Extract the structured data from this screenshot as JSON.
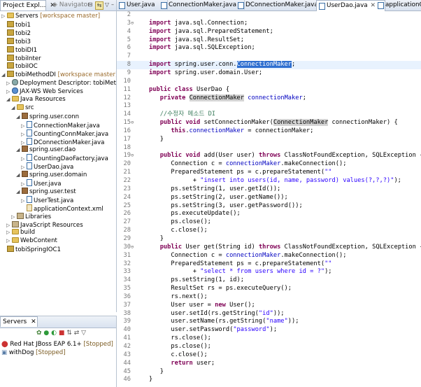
{
  "left_panel": {
    "tabs": [
      {
        "label": "Project Expl...",
        "active": true
      },
      {
        "label": "Navigator",
        "active": false
      }
    ],
    "tree": [
      {
        "label": "Servers",
        "ann": " [workspace master]",
        "indent": 0,
        "twisty": "▷",
        "icon": "folder"
      },
      {
        "label": "tobi1",
        "ann": "",
        "indent": 0,
        "twisty": "",
        "icon": "proj"
      },
      {
        "label": "tobi2",
        "ann": "",
        "indent": 0,
        "twisty": "",
        "icon": "proj"
      },
      {
        "label": "tobi3",
        "ann": "",
        "indent": 0,
        "twisty": "",
        "icon": "proj"
      },
      {
        "label": "tobiDI1",
        "ann": "",
        "indent": 0,
        "twisty": "",
        "icon": "proj"
      },
      {
        "label": "tobiInter",
        "ann": "",
        "indent": 0,
        "twisty": "",
        "icon": "proj"
      },
      {
        "label": "tobiIOC",
        "ann": "",
        "indent": 0,
        "twisty": "",
        "icon": "proj"
      },
      {
        "label": "tobiMethodDI",
        "ann": " [workspace master]",
        "indent": 0,
        "twisty": "◢",
        "icon": "proj"
      },
      {
        "label": "Deployment Descriptor: tobiMethodI",
        "ann": "",
        "indent": 1,
        "twisty": "▷",
        "icon": "gear"
      },
      {
        "label": "JAX-WS Web Services",
        "ann": "",
        "indent": 1,
        "twisty": "▷",
        "icon": "web"
      },
      {
        "label": "Java Resources",
        "ann": "",
        "indent": 1,
        "twisty": "◢",
        "icon": "folder"
      },
      {
        "label": "src",
        "ann": "",
        "indent": 2,
        "twisty": "◢",
        "icon": "folder"
      },
      {
        "label": "spring.user.conn",
        "ann": "",
        "indent": 3,
        "twisty": "◢",
        "icon": "pkg"
      },
      {
        "label": "ConnectionMaker.java",
        "ann": "",
        "indent": 4,
        "twisty": "▷",
        "icon": "java"
      },
      {
        "label": "CountingConnMaker.java",
        "ann": "",
        "indent": 4,
        "twisty": "▷",
        "icon": "java"
      },
      {
        "label": "DConnectionMaker.java",
        "ann": "",
        "indent": 4,
        "twisty": "▷",
        "icon": "java"
      },
      {
        "label": "spring.user.dao",
        "ann": "",
        "indent": 3,
        "twisty": "◢",
        "icon": "pkg"
      },
      {
        "label": "CountingDaoFactory.java",
        "ann": "",
        "indent": 4,
        "twisty": "▷",
        "icon": "java"
      },
      {
        "label": "UserDao.java",
        "ann": "",
        "indent": 4,
        "twisty": "▷",
        "icon": "java"
      },
      {
        "label": "spring.user.domain",
        "ann": "",
        "indent": 3,
        "twisty": "◢",
        "icon": "pkg"
      },
      {
        "label": "User.java",
        "ann": "",
        "indent": 4,
        "twisty": "▷",
        "icon": "java"
      },
      {
        "label": "spring.user.test",
        "ann": "",
        "indent": 3,
        "twisty": "◢",
        "icon": "pkg"
      },
      {
        "label": "UserTest.java",
        "ann": "",
        "indent": 4,
        "twisty": "▷",
        "icon": "java"
      },
      {
        "label": "applicationContext.xml",
        "ann": "",
        "indent": 4,
        "twisty": "",
        "icon": "xml"
      },
      {
        "label": "Libraries",
        "ann": "",
        "indent": 2,
        "twisty": "▷",
        "icon": "lib"
      },
      {
        "label": "JavaScript Resources",
        "ann": "",
        "indent": 1,
        "twisty": "▷",
        "icon": "lib"
      },
      {
        "label": "build",
        "ann": "",
        "indent": 1,
        "twisty": "▷",
        "icon": "folder"
      },
      {
        "label": "WebContent",
        "ann": "",
        "indent": 1,
        "twisty": "▷",
        "icon": "folder"
      },
      {
        "label": "tobiSpringIOC1",
        "ann": "",
        "indent": 0,
        "twisty": "",
        "icon": "proj"
      }
    ]
  },
  "servers_panel": {
    "tab": "Servers",
    "items": [
      {
        "name": "Red Hat JBoss EAP 6.1+",
        "status": " [Stopped]"
      },
      {
        "name": "withDog",
        "status": " [Stopped]"
      }
    ]
  },
  "editor": {
    "tabs": [
      {
        "label": "User.java",
        "active": false
      },
      {
        "label": "ConnectionMaker.java",
        "active": false
      },
      {
        "label": "DConnectionMaker.java",
        "active": false
      },
      {
        "label": "UserDao.java",
        "active": true
      },
      {
        "label": "applicationCor",
        "active": false
      }
    ],
    "current_line": 8,
    "lines": [
      {
        "n": "2",
        "fold": "",
        "html": ""
      },
      {
        "n": "3",
        "fold": "⊖",
        "html": "<span class='k'>import</span> java.sql.Connection;"
      },
      {
        "n": "4",
        "fold": "",
        "html": "<span class='k'>import</span> java.sql.PreparedStatement;"
      },
      {
        "n": "5",
        "fold": "",
        "html": "<span class='k'>import</span> java.sql.ResultSet;"
      },
      {
        "n": "6",
        "fold": "",
        "html": "<span class='k'>import</span> java.sql.SQLException;"
      },
      {
        "n": "7",
        "fold": "",
        "html": ""
      },
      {
        "n": "8",
        "fold": "",
        "html": "<span class='k'>import</span> spring.user.conn.<span class='sel'>ConnectionMaker</span>;"
      },
      {
        "n": "9",
        "fold": "",
        "html": "<span class='k'>import</span> spring.user.domain.User;"
      },
      {
        "n": "10",
        "fold": "",
        "html": ""
      },
      {
        "n": "11",
        "fold": "",
        "html": "<span class='k'>public</span> <span class='k'>class</span> UserDao {"
      },
      {
        "n": "12",
        "fold": "",
        "html": "   <span class='k'>private</span> <span class='sh'>ConnectionMaker</span> <span class='f'>connectionMaker</span>;"
      },
      {
        "n": "13",
        "fold": "",
        "html": ""
      },
      {
        "n": "14",
        "fold": "",
        "html": "   <span class='c'>//수정자 메소드 DI</span>"
      },
      {
        "n": "15",
        "fold": "⊖",
        "html": "   <span class='k'>public</span> <span class='k'>void</span> setConnectionMaker(<span class='sh'>ConnectionMaker</span> connectionMaker) {"
      },
      {
        "n": "16",
        "fold": "",
        "html": "      <span class='k'>this</span>.<span class='f'>connectionMaker</span> = connectionMaker;"
      },
      {
        "n": "17",
        "fold": "",
        "html": "   }"
      },
      {
        "n": "18",
        "fold": "",
        "html": ""
      },
      {
        "n": "19",
        "fold": "⊖",
        "html": "   <span class='k'>public</span> <span class='k'>void</span> add(User user) <span class='k'>throws</span> ClassNotFoundException, SQLException {"
      },
      {
        "n": "20",
        "fold": "",
        "html": "      Connection c = <span class='f'>connectionMaker</span>.makeConnection();"
      },
      {
        "n": "21",
        "fold": "",
        "html": "      PreparedStatement ps = c.prepareStatement(<span class='s'>\"\"</span>"
      },
      {
        "n": "22",
        "fold": "",
        "html": "            + <span class='s'>\"insert into users(id, name, password) values(?,?,?)\"</span>);"
      },
      {
        "n": "23",
        "fold": "",
        "html": "      ps.setString(1, user.getId());"
      },
      {
        "n": "24",
        "fold": "",
        "html": "      ps.setString(2, user.getName());"
      },
      {
        "n": "25",
        "fold": "",
        "html": "      ps.setString(3, user.getPassword());"
      },
      {
        "n": "26",
        "fold": "",
        "html": "      ps.executeUpdate();"
      },
      {
        "n": "27",
        "fold": "",
        "html": "      ps.close();"
      },
      {
        "n": "28",
        "fold": "",
        "html": "      c.close();"
      },
      {
        "n": "29",
        "fold": "",
        "html": "   }"
      },
      {
        "n": "30",
        "fold": "⊖",
        "html": "   <span class='k'>public</span> User get(String id) <span class='k'>throws</span> ClassNotFoundException, SQLException {"
      },
      {
        "n": "31",
        "fold": "",
        "html": "      Connection c = <span class='f'>connectionMaker</span>.makeConnection();"
      },
      {
        "n": "32",
        "fold": "",
        "html": "      PreparedStatement ps = c.prepareStatement(<span class='s'>\"\"</span>"
      },
      {
        "n": "33",
        "fold": "",
        "html": "            + <span class='s'>\"select * from users where id = ?\"</span>);"
      },
      {
        "n": "34",
        "fold": "",
        "html": "      ps.setString(1, id);"
      },
      {
        "n": "35",
        "fold": "",
        "html": "      ResultSet rs = ps.executeQuery();"
      },
      {
        "n": "36",
        "fold": "",
        "html": "      rs.next();"
      },
      {
        "n": "37",
        "fold": "",
        "html": "      User user = <span class='k'>new</span> User();"
      },
      {
        "n": "38",
        "fold": "",
        "html": "      user.setId(rs.getString(<span class='s'>\"id\"</span>));"
      },
      {
        "n": "39",
        "fold": "",
        "html": "      user.setName(rs.getString(<span class='s'>\"name\"</span>));"
      },
      {
        "n": "40",
        "fold": "",
        "html": "      user.setPassword(<span class='s'>\"password\"</span>);"
      },
      {
        "n": "41",
        "fold": "",
        "html": "      rs.close();"
      },
      {
        "n": "42",
        "fold": "",
        "html": "      ps.close();"
      },
      {
        "n": "43",
        "fold": "",
        "html": "      c.close();"
      },
      {
        "n": "44",
        "fold": "",
        "html": "      <span class='k'>return</span> user;"
      },
      {
        "n": "45",
        "fold": "",
        "html": "   }"
      },
      {
        "n": "46",
        "fold": "",
        "html": "}"
      }
    ]
  },
  "colors": {
    "keyword": "#7f0055",
    "string": "#2a00ff",
    "comment": "#3f7f5f",
    "field": "#0000c0",
    "selection": "#2f6fd0",
    "current_line": "#e8f2fe"
  }
}
